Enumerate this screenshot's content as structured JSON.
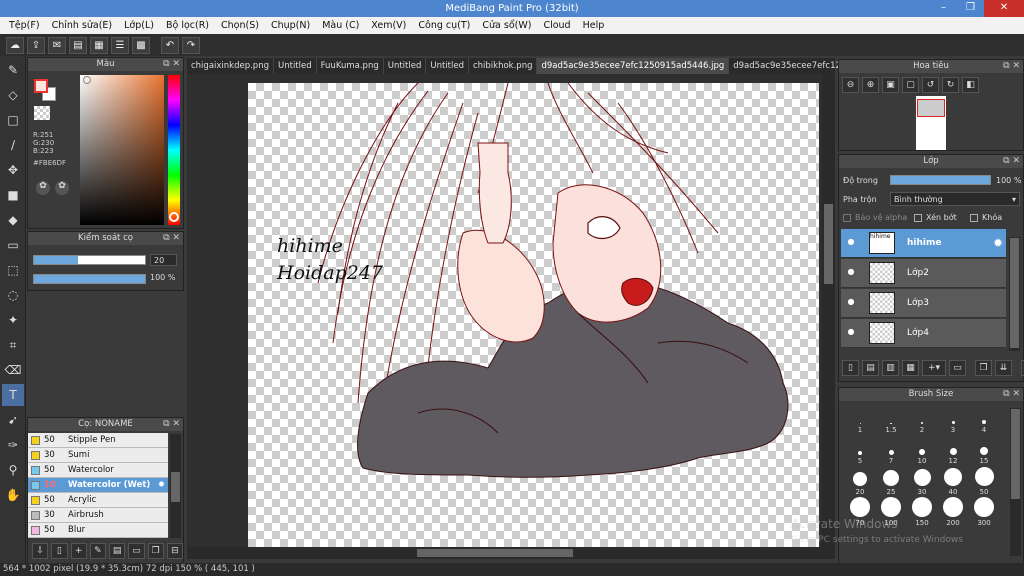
{
  "window": {
    "title": "MediBang Paint Pro (32bit)",
    "controls": [
      "–",
      "❐",
      "✕"
    ]
  },
  "menu": [
    "Tệp(F)",
    "Chỉnh sửa(E)",
    "Lớp(L)",
    "Bộ lọc(R)",
    "Chọn(S)",
    "Chụp(N)",
    "Màu (C)",
    "Xem(V)",
    "Công cụ(T)",
    "Cửa sổ(W)",
    "Cloud",
    "Help"
  ],
  "toolbar": {
    "undo_icon": "undo-icon",
    "redo_icon": "redo-icon"
  },
  "color_panel": {
    "title": "Màu",
    "r": "R:251",
    "g": "G:230",
    "b": "B:223",
    "hex": "#FBE6DF",
    "fg": "#FBE6DF"
  },
  "brush_control": {
    "title": "Kiểm soát cọ",
    "size_value": "20",
    "opacity_value": "100 %",
    "size_fraction": 0.4,
    "opacity_fraction": 1.0
  },
  "brush_list": {
    "title": "Cọ: NONAME",
    "items": [
      {
        "size": "50",
        "name": "Stipple Pen",
        "color": "#f2d21a",
        "selected": false
      },
      {
        "size": "30",
        "name": "Sumi",
        "color": "#f2d21a",
        "selected": false
      },
      {
        "size": "50",
        "name": "Watercolor",
        "color": "#7ac7f0",
        "selected": false
      },
      {
        "size": "10",
        "name": "Watercolor (Wet)",
        "color": "#7ac7f0",
        "selected": true
      },
      {
        "size": "50",
        "name": "Acrylic",
        "color": "#f2d21a",
        "selected": false
      },
      {
        "size": "30",
        "name": "Airbrush",
        "color": "#bbbbbb",
        "selected": false
      },
      {
        "size": "50",
        "name": "Blur",
        "color": "#f4b8e0",
        "selected": false
      }
    ]
  },
  "tabs": [
    "chigaixinkdep.png",
    "Untitled",
    "FuuKuma.png",
    "Untitled",
    "Untitled",
    "chibikhok.png",
    "d9ad5ac9e35ecee7efc1250915ad5446.jpg",
    "d9ad5ac9e35ecee7efc1250915ad5446.jpg"
  ],
  "active_tab": 6,
  "canvas": {
    "text1": "hihime",
    "text2": "Hoidap247"
  },
  "status": "564 * 1002 pixel  (19.9 * 35.3cm)  72 dpi  150 %  ( 445, 101 )",
  "navigator": {
    "title": "Hoa tiêu"
  },
  "layers": {
    "title": "Lớp",
    "opacity_label": "Độ trong",
    "opacity_value": "100 %",
    "opacity_fraction": 1.0,
    "blend_label": "Pha trộn",
    "blend_value": "Bình thường",
    "protect_alpha": "Bảo vệ alpha",
    "clip": "Xén bớt",
    "lock": "Khóa",
    "items": [
      {
        "name": "hihime",
        "selected": true
      },
      {
        "name": "Lớp2",
        "selected": false
      },
      {
        "name": "Lớp3",
        "selected": false
      },
      {
        "name": "Lớp4",
        "selected": false
      }
    ]
  },
  "brush_size": {
    "title": "Brush Size",
    "sizes": [
      "1",
      "1.5",
      "2",
      "3",
      "4",
      "5",
      "7",
      "10",
      "12",
      "15",
      "20",
      "25",
      "30",
      "40",
      "50",
      "70",
      "100",
      "150",
      "200",
      "300"
    ]
  },
  "watermark": {
    "line1": "Activate Windows",
    "line2": "Go to PC settings to activate Windows"
  }
}
